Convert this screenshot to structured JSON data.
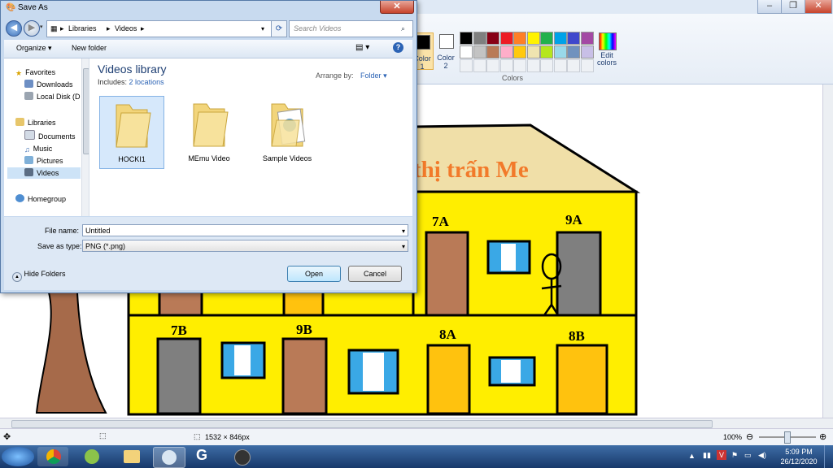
{
  "dialog": {
    "title": "Save As",
    "close_label": "✕",
    "address": {
      "crumb1": "Libraries",
      "crumb2": "Videos"
    },
    "search_placeholder": "Search Videos",
    "toolbar": {
      "organize": "Organize ▾",
      "new_folder": "New folder"
    },
    "nav": {
      "favorites": "Favorites",
      "downloads": "Downloads",
      "local_disk": "Local Disk (D",
      "libraries": "Libraries",
      "documents": "Documents",
      "music": "Music",
      "pictures": "Pictures",
      "videos": "Videos",
      "homegroup": "Homegroup"
    },
    "library": {
      "title": "Videos library",
      "includes_label": "Includes:",
      "locations_link": "2 locations",
      "arrange_label": "Arrange by:",
      "arrange_value": "Folder"
    },
    "files": [
      {
        "name": "HOCKI1"
      },
      {
        "name": "MEmu Video"
      },
      {
        "name": "Sample Videos"
      }
    ],
    "file_name_label": "File name:",
    "file_name_value": "Untitled",
    "save_type_label": "Save as type:",
    "save_type_value": "PNG (*.png)",
    "hide_folders": "Hide Folders",
    "open_button": "Open",
    "cancel_button": "Cancel"
  },
  "paint": {
    "color1": "Color 1",
    "color2": "Color 2",
    "edit_colors": "Edit colors",
    "colors_group": "Colors",
    "palette_row1": [
      "#000000",
      "#7f7f7f",
      "#880015",
      "#ed1c24",
      "#ff7f27",
      "#fff200",
      "#22b14c",
      "#00a2e8",
      "#3f48cc",
      "#a349a4"
    ],
    "palette_row2": [
      "#ffffff",
      "#c3c3c3",
      "#b97a57",
      "#ffaec9",
      "#ffc90e",
      "#efe4b0",
      "#b5e61d",
      "#99d9ea",
      "#7092be",
      "#c8bfe7"
    ],
    "canvas": {
      "sign_text": "thị trấn Me",
      "labels": [
        "7A",
        "9A",
        "7B",
        "9B",
        "8A",
        "8B"
      ]
    },
    "status_size": "1532 × 846px",
    "zoom": "100%"
  },
  "taskbar": {
    "time": "5:09 PM",
    "date": "26/12/2020"
  },
  "colors": {
    "house_yellow": "#ffee00",
    "roof": "#f0dfa8",
    "door_brown": "#b97a57",
    "door_gray": "#7f7f7f",
    "door_orange": "#ffc20e",
    "window_blue": "#3aa8e6",
    "sign_orange": "#f27a2a",
    "tree": "#a66a4a"
  }
}
